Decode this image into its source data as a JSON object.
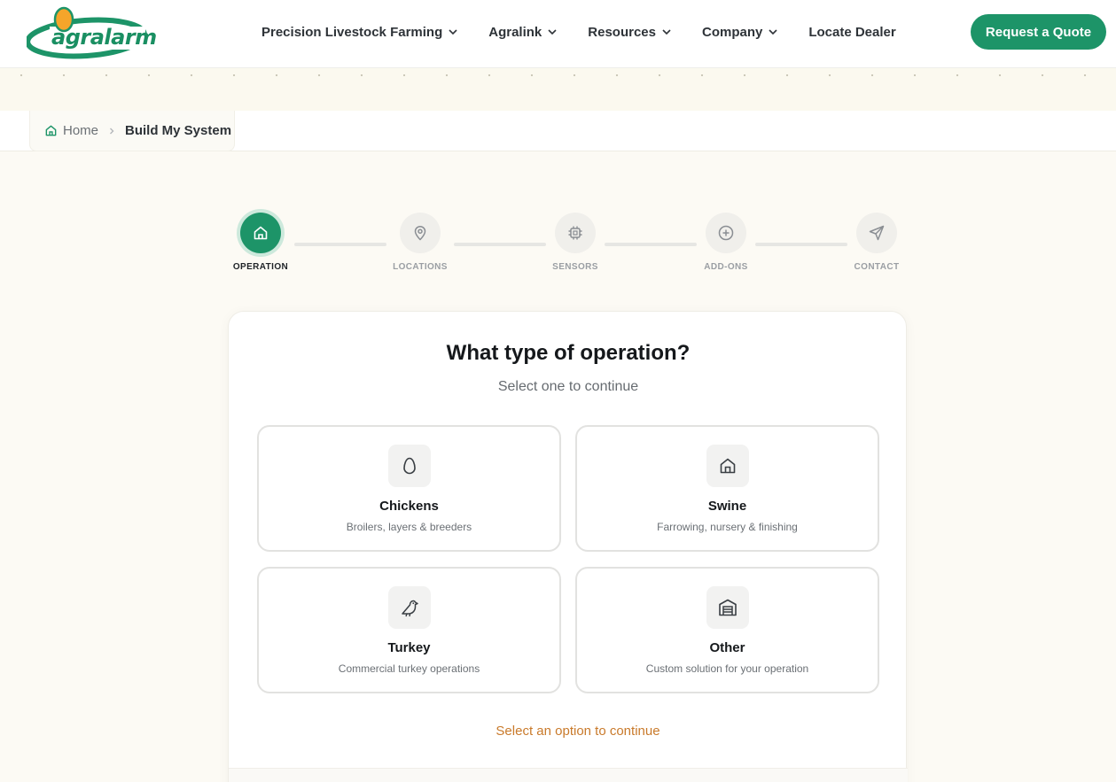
{
  "brand": {
    "name": "agralarm",
    "accent": "#1d9468",
    "egg_color": "#f5a52a"
  },
  "nav": {
    "items": [
      {
        "label": "Precision Livestock Farming",
        "has_dropdown": true
      },
      {
        "label": "Agralink",
        "has_dropdown": true
      },
      {
        "label": "Resources",
        "has_dropdown": true
      },
      {
        "label": "Company",
        "has_dropdown": true
      },
      {
        "label": "Locate Dealer",
        "has_dropdown": false
      }
    ],
    "cta_label": "Request a Quote"
  },
  "breadcrumb": {
    "home": "Home",
    "current": "Build My System"
  },
  "stepper": {
    "steps": [
      {
        "label": "OPERATION",
        "icon": "home-icon",
        "active": true
      },
      {
        "label": "LOCATIONS",
        "icon": "map-pin-icon",
        "active": false
      },
      {
        "label": "SENSORS",
        "icon": "chip-icon",
        "active": false
      },
      {
        "label": "ADD-ONS",
        "icon": "plus-circle-icon",
        "active": false
      },
      {
        "label": "CONTACT",
        "icon": "send-icon",
        "active": false
      }
    ]
  },
  "question": {
    "title": "What type of operation?",
    "subtitle": "Select one to continue",
    "options": [
      {
        "title": "Chickens",
        "description": "Broilers, layers & breeders",
        "icon": "egg-icon"
      },
      {
        "title": "Swine",
        "description": "Farrowing, nursery & finishing",
        "icon": "barn-icon"
      },
      {
        "title": "Turkey",
        "description": "Commercial turkey operations",
        "icon": "bird-icon"
      },
      {
        "title": "Other",
        "description": "Custom solution for your operation",
        "icon": "warehouse-icon"
      }
    ],
    "hint": "Select an option to continue"
  }
}
